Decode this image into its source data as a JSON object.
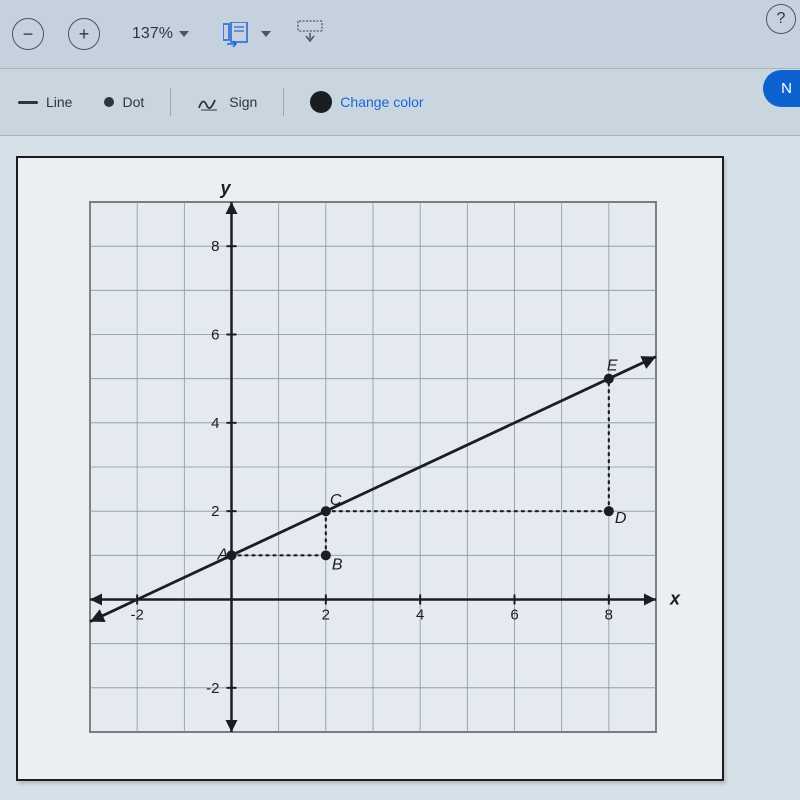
{
  "toolbar": {
    "zoom_value": "137%",
    "line_label": "Line",
    "dot_label": "Dot",
    "sign_label": "Sign",
    "color_label": "Change color",
    "next_label": "N"
  },
  "chart_data": {
    "type": "line",
    "title": "",
    "xlabel": "x",
    "ylabel": "y",
    "xlim": [
      -3,
      9
    ],
    "ylim": [
      -3,
      9
    ],
    "ticks_x": [
      -2,
      2,
      4,
      6,
      8
    ],
    "ticks_y": [
      -2,
      2,
      4,
      6,
      8
    ],
    "series": [
      {
        "name": "line",
        "type": "line",
        "x": [
          -3,
          9
        ],
        "y": [
          -0.5,
          5.5
        ],
        "style": "solid"
      },
      {
        "name": "AB",
        "type": "line",
        "x": [
          0,
          2
        ],
        "y": [
          1,
          1
        ],
        "style": "dotted"
      },
      {
        "name": "BC",
        "type": "line",
        "x": [
          2,
          2
        ],
        "y": [
          1,
          2
        ],
        "style": "dotted"
      },
      {
        "name": "CD",
        "type": "line",
        "x": [
          2,
          8
        ],
        "y": [
          2,
          2
        ],
        "style": "dotted"
      },
      {
        "name": "DE",
        "type": "line",
        "x": [
          8,
          8
        ],
        "y": [
          2,
          5
        ],
        "style": "dotted"
      }
    ],
    "points": [
      {
        "name": "A",
        "x": 0,
        "y": 1,
        "label_dx": -14,
        "label_dy": 4
      },
      {
        "name": "B",
        "x": 2,
        "y": 1,
        "label_dx": 6,
        "label_dy": 14
      },
      {
        "name": "C",
        "x": 2,
        "y": 2,
        "label_dx": 4,
        "label_dy": -6
      },
      {
        "name": "D",
        "x": 8,
        "y": 2,
        "label_dx": 6,
        "label_dy": 12
      },
      {
        "name": "E",
        "x": 8,
        "y": 5,
        "label_dx": -2,
        "label_dy": -8
      }
    ]
  }
}
